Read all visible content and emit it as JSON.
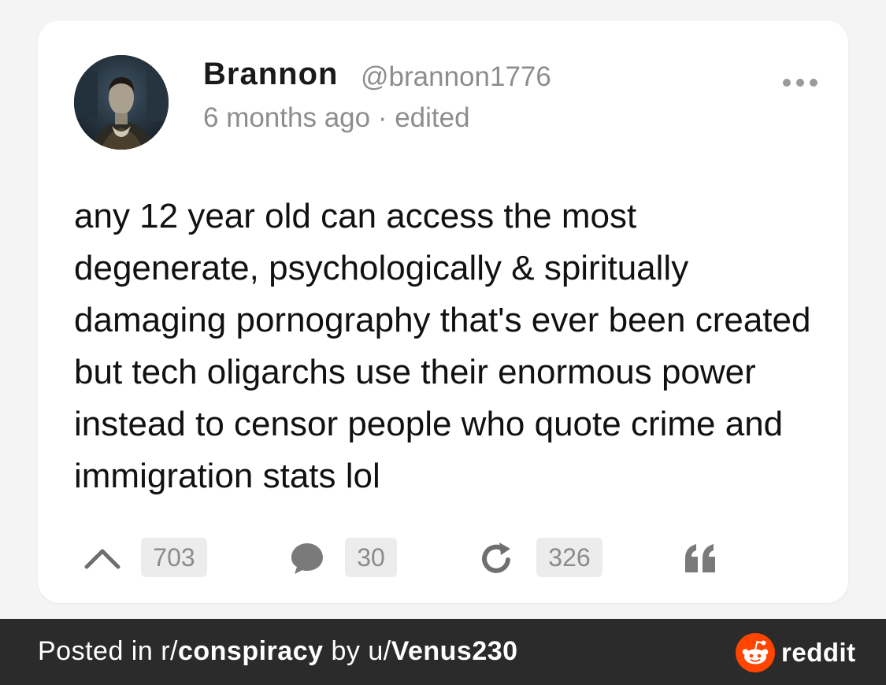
{
  "post": {
    "author": {
      "name": "Brannon",
      "handle": "@brannon1776"
    },
    "time": "6 months ago",
    "separator": "·",
    "edited": "edited",
    "body": "any 12 year old can access the most degenerate, psychologically & spiritually damaging pornography that's ever been created but tech oligarchs use their enormous power instead to censor people who quote crime and immigration stats lol",
    "actions": {
      "upvote_icon": "chevron-up-icon",
      "upvotes": "703",
      "comment_icon": "speech-bubble-icon",
      "comments": "30",
      "repost_icon": "refresh-icon",
      "reposts": "326",
      "quote_icon": "quote-icon"
    }
  },
  "footer": {
    "prefix": "Posted in r/",
    "subreddit": "conspiracy",
    "by": " by u/",
    "user": "Venus230",
    "brand": "reddit",
    "brand_color": "#ff4500"
  },
  "colors": {
    "background": "#f4f4f4",
    "card": "#ffffff",
    "muted_text": "#8d8d8d",
    "count_bg": "#ececec",
    "footer_bg": "#2b2b2b"
  }
}
